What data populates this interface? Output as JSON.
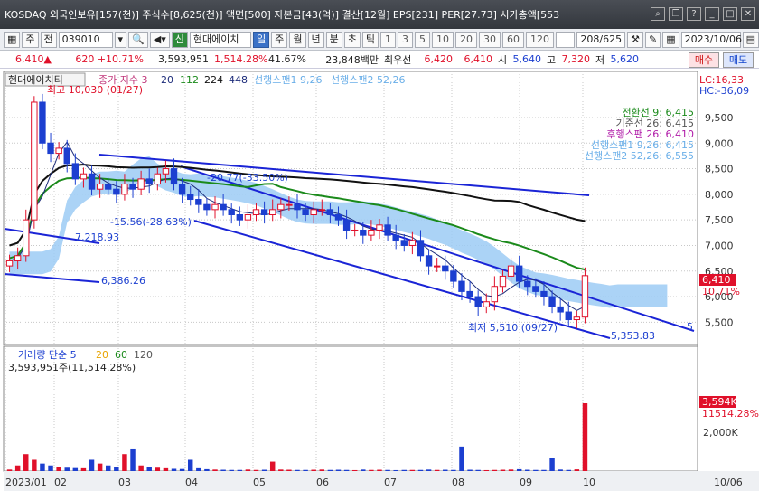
{
  "title_bar": {
    "text": "KOSDAQ 외국인보유[157(천)] 주식수[8,625(천)] 액면[500] 자본금[43(억)] 결산[12월] EPS[231] PER[27.73] 시가총액[553"
  },
  "toolbar": {
    "mode": "주",
    "ju": "전",
    "code": "039010",
    "stock_name": "현대에이치",
    "sin": "신",
    "periods": [
      "일",
      "주",
      "월",
      "년",
      "분",
      "초",
      "틱"
    ],
    "selected_period": "일",
    "intervals": [
      "1",
      "3",
      "5",
      "10",
      "20",
      "30",
      "60",
      "120"
    ],
    "count": "208/625",
    "date": "2023/10/06"
  },
  "price_bar": {
    "price": "6,410▲",
    "change": "620 +10.71%",
    "volume": "3,593,951",
    "volume_ratio": "1,514.28%",
    "ratio2": "41.67%",
    "amount": "23,848백만",
    "best_ask_label": "최우선",
    "best_ask": "6,420",
    "best_bid": "6,410",
    "open_label": "시",
    "open": "5,640",
    "high_label": "고",
    "high": "7,320",
    "low_label": "저",
    "low": "5,620",
    "sell": "매수",
    "buy": "매도"
  },
  "legend": {
    "name": "현대에이치티",
    "ma_label": "종가 지수 3",
    "ma_values": [
      "20",
      "112",
      "224",
      "448"
    ],
    "span1": "선행스팬1 9,26",
    "span2": "선행스팬2 52,26",
    "lc": "LC:16,33",
    "hc": "HC:-36,09"
  },
  "ichimoku_labels": {
    "conv": "전환선 9: 6,415",
    "base": "기준선 26: 6,415",
    "lag": "후행스팬 26: 6,410",
    "s1": "선행스팬1 9,26: 6,415",
    "s2": "선행스팬2 52,26: 6,555"
  },
  "annotations": {
    "high": "최고 10,030 (01/27)",
    "low": "최저 5,510 (09/27)",
    "pct1": "-20.77(-33.50%)",
    "pct2": "-15.56(-28.63%)",
    "lv1": "7,218.93",
    "lv2": "6,386.26",
    "lv3": "5,353.83",
    "five": "5"
  },
  "price_axis": [
    "9,500",
    "9,000",
    "8,500",
    "8,000",
    "7,500",
    "7,000",
    "6,500",
    "6,000",
    "5,500"
  ],
  "price_badge": {
    "value": "6,410",
    "pct": "10.71%"
  },
  "volume_legend": {
    "label": "거래량 단순 5",
    "mas": [
      "20",
      "60",
      "120"
    ],
    "value": "3,593,951주(11,514.28%)"
  },
  "volume_axis": [
    "2,000K"
  ],
  "volume_badge": {
    "value": "3,594K",
    "pct": "11514.28%"
  },
  "date_axis": [
    "2023/01",
    "02",
    "03",
    "04",
    "05",
    "06",
    "07",
    "08",
    "09",
    "10"
  ],
  "last_date": "10/06",
  "chart_data": {
    "type": "candlestick",
    "title": "",
    "ylim": [
      5100,
      10100
    ],
    "closes": [
      6700,
      6800,
      7500,
      9800,
      9000,
      8800,
      8900,
      8600,
      8300,
      8400,
      8100,
      8200,
      8100,
      8000,
      8200,
      8100,
      8300,
      8200,
      8400,
      8500,
      8200,
      8000,
      7900,
      7800,
      7700,
      7800,
      7700,
      7600,
      7500,
      7600,
      7700,
      7600,
      7700,
      7800,
      7800,
      7700,
      7600,
      7700,
      7700,
      7600,
      7500,
      7300,
      7300,
      7200,
      7300,
      7400,
      7200,
      7100,
      7000,
      7100,
      6800,
      6600,
      6600,
      6500,
      6300,
      6100,
      6000,
      5800,
      5900,
      6200,
      6400,
      6600,
      6300,
      6200,
      6100,
      6000,
      5800,
      5700,
      5550,
      5600,
      6410
    ],
    "volume_max_K": 3594,
    "volumes_K": [
      80,
      300,
      900,
      600,
      400,
      300,
      200,
      180,
      160,
      150,
      600,
      400,
      300,
      200,
      900,
      1200,
      300,
      200,
      180,
      150,
      120,
      110,
      600,
      150,
      100,
      80,
      70,
      60,
      60,
      80,
      60,
      70,
      500,
      80,
      70,
      60,
      60,
      70,
      80,
      60,
      70,
      60,
      50,
      80,
      60,
      70,
      60,
      50,
      60,
      60,
      60,
      80,
      60,
      70,
      60,
      1300,
      70,
      60,
      50,
      60,
      70,
      80,
      100,
      70,
      60,
      60,
      700,
      80,
      60,
      90,
      3594
    ]
  }
}
